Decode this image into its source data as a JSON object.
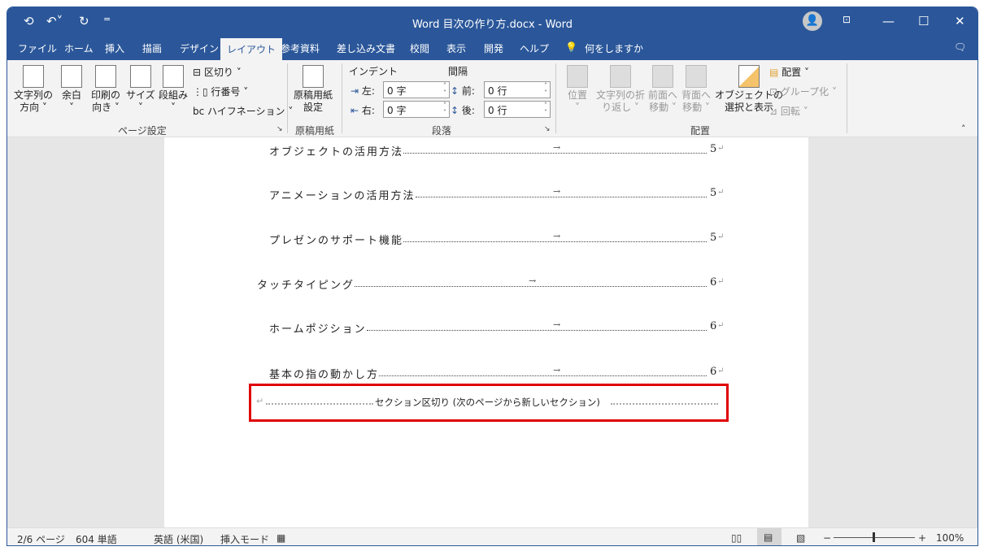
{
  "title_bar": {
    "title": "Word  目次の作り方.docx  -  Word",
    "save_icon": "autosave-icon",
    "undo_icon": "undo-icon",
    "redo_icon": "redo-icon",
    "customize": "="
  },
  "tabs": [
    "ファイル",
    "ホーム",
    "挿入",
    "描画",
    "デザイン",
    "レイアウト",
    "参考資料",
    "差し込み文書",
    "校閲",
    "表示",
    "開発",
    "ヘルプ"
  ],
  "active_tab": "レイアウト",
  "tell_me": "何をしますか",
  "ribbon": {
    "page_setup": {
      "label": "ページ設定",
      "text_direction": [
        "文字列の",
        "方向 ˅"
      ],
      "margins": [
        "余白",
        "˅"
      ],
      "orientation": [
        "印刷の",
        "向き ˅"
      ],
      "size": [
        "サイズ",
        "˅"
      ],
      "columns": [
        "段組み",
        "˅"
      ],
      "breaks": "区切り ˅",
      "line_numbers": "行番号 ˅",
      "hyphenation": "ハイフネーション ˅"
    },
    "manuscript": {
      "label": "原稿用紙",
      "button": [
        "原稿用紙",
        "設定"
      ]
    },
    "paragraph": {
      "label": "段落",
      "indent": "インデント",
      "spacing": "間隔",
      "left_label": "左:",
      "left_value": "0 字",
      "right_label": "右:",
      "right_value": "0 字",
      "before_label": "前:",
      "before_value": "0 行",
      "after_label": "後:",
      "after_value": "0 行"
    },
    "arrange": {
      "label": "配置",
      "position": [
        "位置",
        "˅"
      ],
      "wrap": [
        "文字列の折",
        "り返し ˅"
      ],
      "forward": [
        "前面へ",
        "移動 ˅"
      ],
      "backward": [
        "背面へ",
        "移動 ˅"
      ],
      "selection_pane": [
        "オブジェクトの",
        "選択と表示"
      ],
      "align": "配置 ˅",
      "group": "グループ化 ˅",
      "rotate": "回転 ˅"
    }
  },
  "document": {
    "toc": [
      {
        "text": "オブジェクトの活用方法",
        "page": "5",
        "level": 2
      },
      {
        "text": "アニメーションの活用方法",
        "page": "5",
        "level": 2
      },
      {
        "text": "プレゼンのサポート機能",
        "page": "5",
        "level": 2
      },
      {
        "text": "タッチタイピング",
        "page": "6",
        "level": 1
      },
      {
        "text": "ホームポジション",
        "page": "6",
        "level": 2
      },
      {
        "text": "基本の指の動かし方",
        "page": "6",
        "level": 2
      }
    ],
    "section_break": "セクション区切り (次のページから新しいセクション)",
    "highlight_color": "#e00000"
  },
  "status": {
    "page": "2/6 ページ",
    "words": "604 単語",
    "language": "英語 (米国)",
    "mode": "挿入モード",
    "zoom": "100%"
  },
  "colors": {
    "brand": "#2b579a"
  }
}
